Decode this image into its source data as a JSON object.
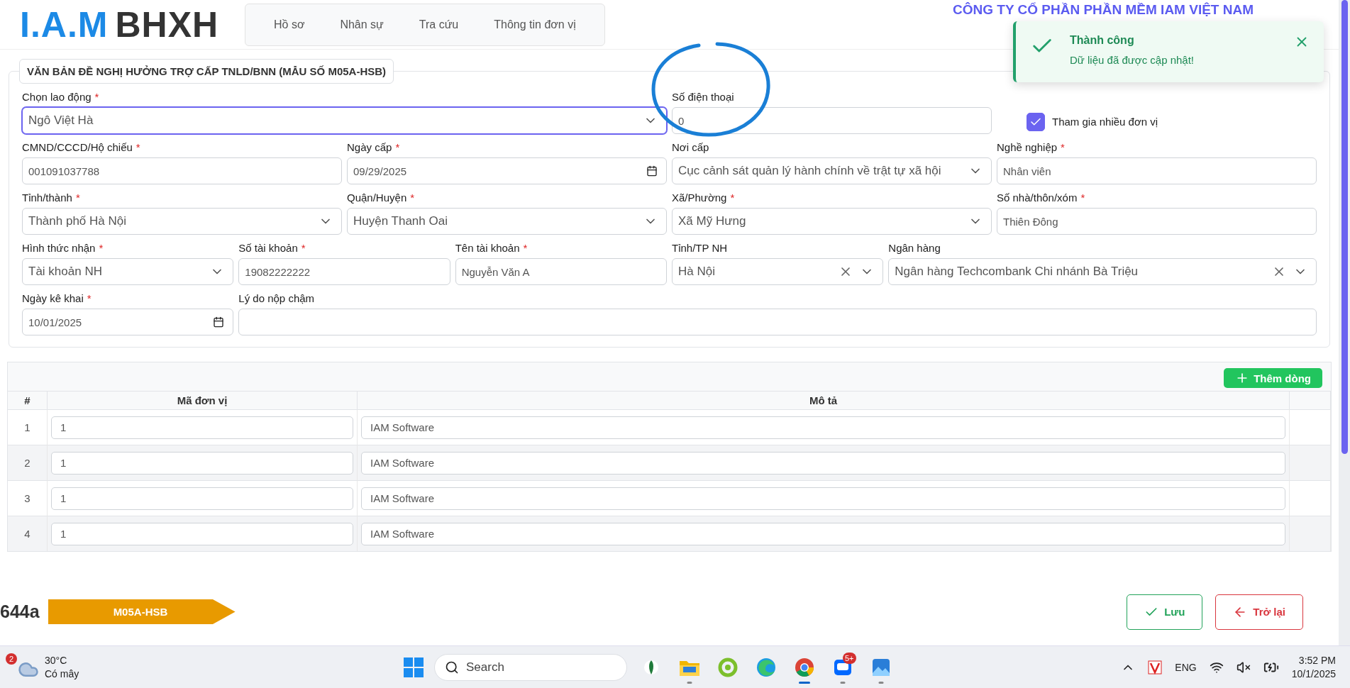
{
  "header": {
    "logo_mark": "I.A.M",
    "logo_word": "BHXH",
    "nav": [
      {
        "label": "Hồ sơ"
      },
      {
        "label": "Nhân sự"
      },
      {
        "label": "Tra cứu"
      },
      {
        "label": "Thông tin đơn vị"
      }
    ],
    "company": "CÔNG TY CỔ PHẦN PHẦN MỀM IAM VIỆT NAM"
  },
  "toast": {
    "title": "Thành công",
    "message": "Dữ liệu đã được cập nhật!"
  },
  "form": {
    "title": "VĂN BẢN ĐỀ NGHỊ HƯỞNG TRỢ CẤP TNLD/BNN (MẪU SỐ M05A-HSB)",
    "rows": [
      {
        "fields": [
          {
            "kind": "select",
            "label": "Chọn lao động",
            "required_mark": "*",
            "value": "Ngô Việt Hà",
            "focused": true,
            "circled": false
          },
          {
            "kind": "text",
            "label": "Số điện thoại",
            "value": "0",
            "focused": false,
            "circled": true
          },
          {
            "kind": "checkbox",
            "label": "Tham gia nhiều đơn vị",
            "checked": true
          }
        ]
      },
      {
        "fields": [
          {
            "kind": "text",
            "label": "CMND/CCCD/Hộ chiếu",
            "required_mark": "*",
            "value": "001091037788",
            "focused": false,
            "circled": false
          },
          {
            "kind": "date",
            "label": "Ngày cấp",
            "required_mark": "*",
            "value": "09/29/2025",
            "focused": false,
            "circled": false
          },
          {
            "kind": "select",
            "label": "Nơi cấp",
            "value": "Cục cảnh sát quản lý hành chính về trật tự xã hội",
            "focused": false,
            "circled": false
          },
          {
            "kind": "text",
            "label": "Nghề nghiệp",
            "required_mark": "*",
            "value": "Nhân viên",
            "focused": false,
            "circled": false
          }
        ]
      },
      {
        "fields": [
          {
            "kind": "select",
            "label": "Tỉnh/thành",
            "required_mark": "*",
            "value": "Thành phố Hà Nội",
            "focused": false,
            "circled": false
          },
          {
            "kind": "select",
            "label": "Quận/Huyện",
            "required_mark": "*",
            "value": "Huyện Thanh Oai",
            "focused": false,
            "circled": false
          },
          {
            "kind": "select",
            "label": "Xã/Phường",
            "required_mark": "*",
            "value": "Xã Mỹ Hưng",
            "focused": false,
            "circled": false
          },
          {
            "kind": "text",
            "label": "Số nhà/thôn/xóm",
            "required_mark": "*",
            "value": "Thiên Đông",
            "focused": false,
            "circled": false
          }
        ]
      },
      {
        "fields": [
          {
            "kind": "select",
            "label": "Hình thức nhận",
            "required_mark": "*",
            "value": "Tài khoản NH",
            "focused": false,
            "circled": false
          },
          {
            "kind": "text",
            "label": "Số tài khoản",
            "required_mark": "*",
            "value": "19082222222",
            "focused": false,
            "circled": false
          },
          {
            "kind": "text",
            "label": "Tên tài khoản",
            "required_mark": "*",
            "value": "Nguyễn Văn A",
            "focused": false,
            "circled": false
          },
          {
            "kind": "clearable",
            "label": "Tỉnh/TP NH",
            "value": "Hà Nội",
            "focused": false,
            "circled": false
          },
          {
            "kind": "clearable",
            "label": "Ngân hàng",
            "value": "Ngân hàng Techcombank Chi nhánh Bà Triệu",
            "focused": false,
            "circled": false
          }
        ]
      },
      {
        "fields": [
          {
            "kind": "date",
            "label": "Ngày kê khai",
            "required_mark": "*",
            "value": "10/01/2025",
            "focused": false,
            "circled": false
          },
          {
            "kind": "text",
            "label": "Lý do nộp chậm",
            "focused": false,
            "circled": false
          }
        ]
      }
    ]
  },
  "table": {
    "add_button": "Thêm dòng",
    "columns": [
      "#",
      "Mã đơn vị",
      "Mô tả"
    ],
    "rows": [
      {
        "index": "1",
        "code": "1",
        "description": "IAM Software"
      },
      {
        "index": "2",
        "code": "1",
        "description": "IAM Software"
      },
      {
        "index": "3",
        "code": "1",
        "description": "IAM Software"
      },
      {
        "index": "4",
        "code": "1",
        "description": "IAM Software"
      }
    ]
  },
  "footer": {
    "code_fragment": "644a",
    "form_tag": "M05A-HSB",
    "buttons": [
      {
        "kind": "save",
        "label": "Lưu"
      },
      {
        "kind": "back",
        "label": "Trở lại"
      }
    ]
  },
  "taskbar": {
    "weather": {
      "badge": "2",
      "temperature": "30°C",
      "condition": "Có mây"
    },
    "search_placeholder": "Search",
    "apps": [
      {
        "kind": "leaf",
        "running": false,
        "active": false
      },
      {
        "kind": "folder",
        "running": true,
        "active": false
      },
      {
        "kind": "green",
        "running": false,
        "active": false
      },
      {
        "kind": "edge",
        "running": false,
        "active": false
      },
      {
        "kind": "chrome",
        "running": true,
        "active": true
      },
      {
        "kind": "zalo",
        "running": true,
        "active": false,
        "badge": "5+"
      },
      {
        "kind": "photos",
        "running": true,
        "active": false
      }
    ],
    "language": "ENG",
    "time": "3:52 PM",
    "date": "10/1/2025"
  }
}
